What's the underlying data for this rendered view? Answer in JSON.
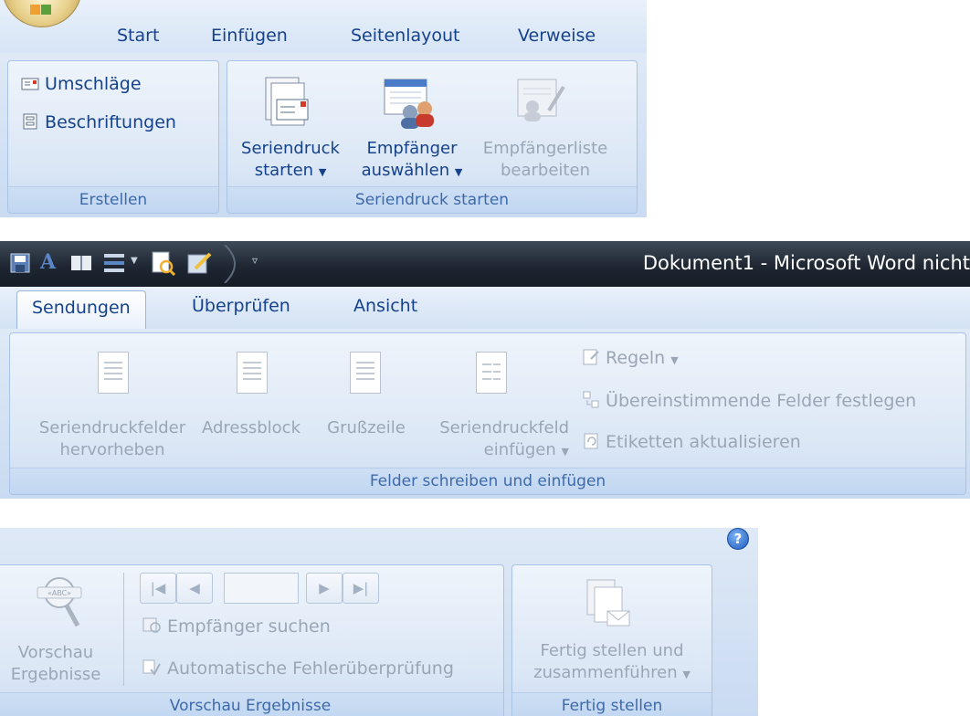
{
  "ribbon_top": {
    "tabs": [
      "Start",
      "Einfügen",
      "Seitenlayout",
      "Verweise"
    ],
    "groups": {
      "erstellen": {
        "label": "Erstellen",
        "items": [
          {
            "label": "Umschläge",
            "icon": "envelope-icon"
          },
          {
            "label": "Beschriftungen",
            "icon": "label-sheet-icon"
          }
        ]
      },
      "seriendruck_starten": {
        "label": "Seriendruck starten",
        "buttons": [
          {
            "line1": "Seriendruck",
            "line2": "starten",
            "dropdown": true,
            "enabled": true,
            "icon": "mail-merge-start-icon"
          },
          {
            "line1": "Empfänger",
            "line2": "auswählen",
            "dropdown": true,
            "enabled": true,
            "icon": "select-recipients-icon"
          },
          {
            "line1": "Empfängerliste",
            "line2": "bearbeiten",
            "dropdown": false,
            "enabled": false,
            "icon": "edit-recipient-list-icon"
          }
        ]
      }
    }
  },
  "window": {
    "title": "Dokument1 - Microsoft Word nicht",
    "quick_access_icons": [
      "save-icon",
      "font-icon",
      "book-icon",
      "list-icon",
      "print-preview-icon",
      "edit-icon",
      "customize-qat-icon"
    ]
  },
  "ribbon_mid": {
    "tabs": [
      "Sendungen",
      "Überprüfen",
      "Ansicht"
    ],
    "active_tab": "Sendungen",
    "group": {
      "label": "Felder schreiben und einfügen",
      "big_buttons": [
        {
          "line1": "Seriendruckfelder",
          "line2": "hervorheben",
          "dropdown": false
        },
        {
          "line1": "Adressblock",
          "line2": "",
          "dropdown": false
        },
        {
          "line1": "Grußzeile",
          "line2": "",
          "dropdown": false
        },
        {
          "line1": "Seriendruckfeld",
          "line2": "einfügen",
          "dropdown": true
        }
      ],
      "small_buttons": [
        {
          "label": "Regeln",
          "dropdown": true,
          "icon": "rules-icon"
        },
        {
          "label": "Übereinstimmende Felder festlegen",
          "dropdown": false,
          "icon": "match-fields-icon"
        },
        {
          "label": "Etiketten aktualisieren",
          "dropdown": false,
          "icon": "update-labels-icon"
        }
      ]
    }
  },
  "ribbon_bottom": {
    "help_label": "?",
    "vorschau_group": {
      "label": "Vorschau Ergebnisse",
      "preview_button": {
        "line1": "Vorschau",
        "line2": "Ergebnisse",
        "badge": "«ABC»"
      },
      "record_value": "",
      "small_buttons": [
        {
          "label": "Empfänger suchen",
          "icon": "find-recipient-icon"
        },
        {
          "label": "Automatische Fehlerüberprüfung",
          "icon": "auto-check-errors-icon"
        }
      ]
    },
    "fertig_group": {
      "label": "Fertig stellen",
      "button": {
        "line1": "Fertig stellen und",
        "line2": "zusammenführen",
        "dropdown": true
      }
    }
  },
  "colors": {
    "tab_text": "#15428b",
    "disabled_text": "#9aa6b5",
    "title_bar": "#1f2733",
    "group_label": "#3e6aaa"
  }
}
